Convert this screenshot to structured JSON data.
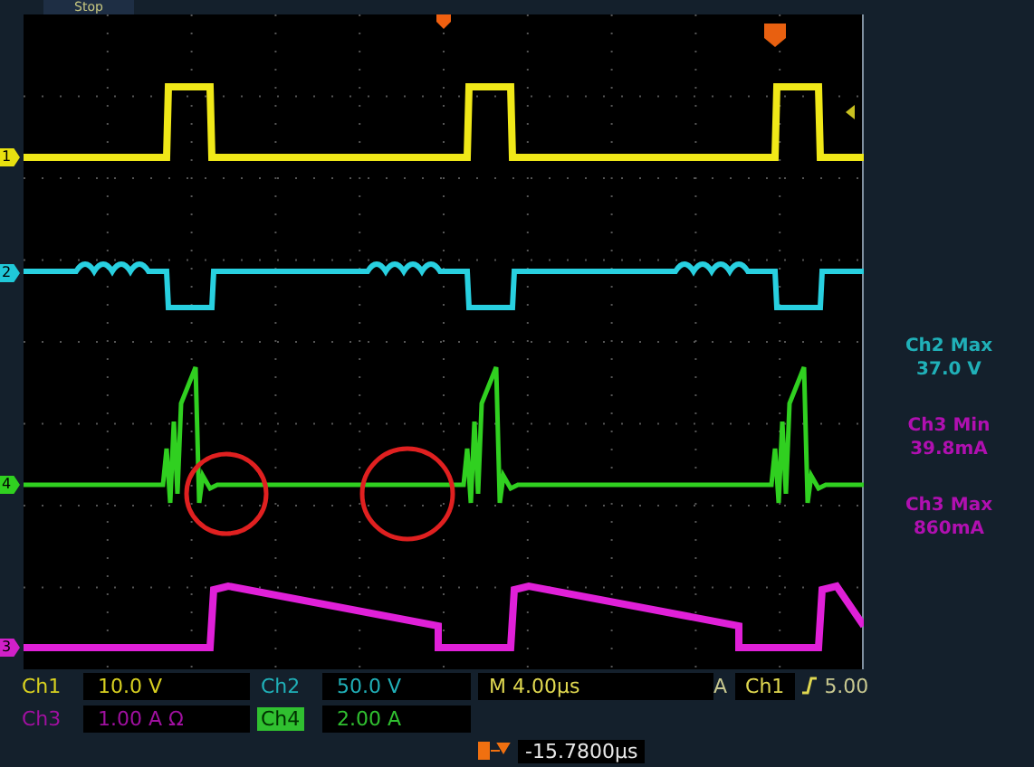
{
  "status": "Stop",
  "channel_markers": [
    {
      "label": "1",
      "color": "#e8e010"
    },
    {
      "label": "2",
      "color": "#20c8d8"
    },
    {
      "label": "4",
      "color": "#30d020"
    },
    {
      "label": "3",
      "color": "#d020c8"
    }
  ],
  "measurements": [
    {
      "name": "Ch2 Max",
      "value": "37.0 V",
      "color": "#20b0b8"
    },
    {
      "name": "Ch3 Min",
      "value": "39.8mA",
      "color": "#b010b0"
    },
    {
      "name": "Ch3 Max",
      "value": "860mA",
      "color": "#b010b0"
    }
  ],
  "readouts": [
    {
      "channel": "Ch1",
      "scale": "10.0 V",
      "color": "#d8d020",
      "selected": false
    },
    {
      "channel": "Ch2",
      "scale": "50.0 V",
      "color": "#20b0b8",
      "selected": false
    },
    {
      "channel": "Ch3",
      "scale": "1.00 A Ω",
      "color": "#a010a0",
      "selected": false
    },
    {
      "channel": "Ch4",
      "scale": "2.00 A",
      "color": "#30c030",
      "selected": true
    }
  ],
  "timebase": {
    "label": "M",
    "value": "4.00µs"
  },
  "trigger": {
    "label": "A",
    "source": "Ch1",
    "level": "5.00"
  },
  "trigger_position": "-15.7800µs"
}
